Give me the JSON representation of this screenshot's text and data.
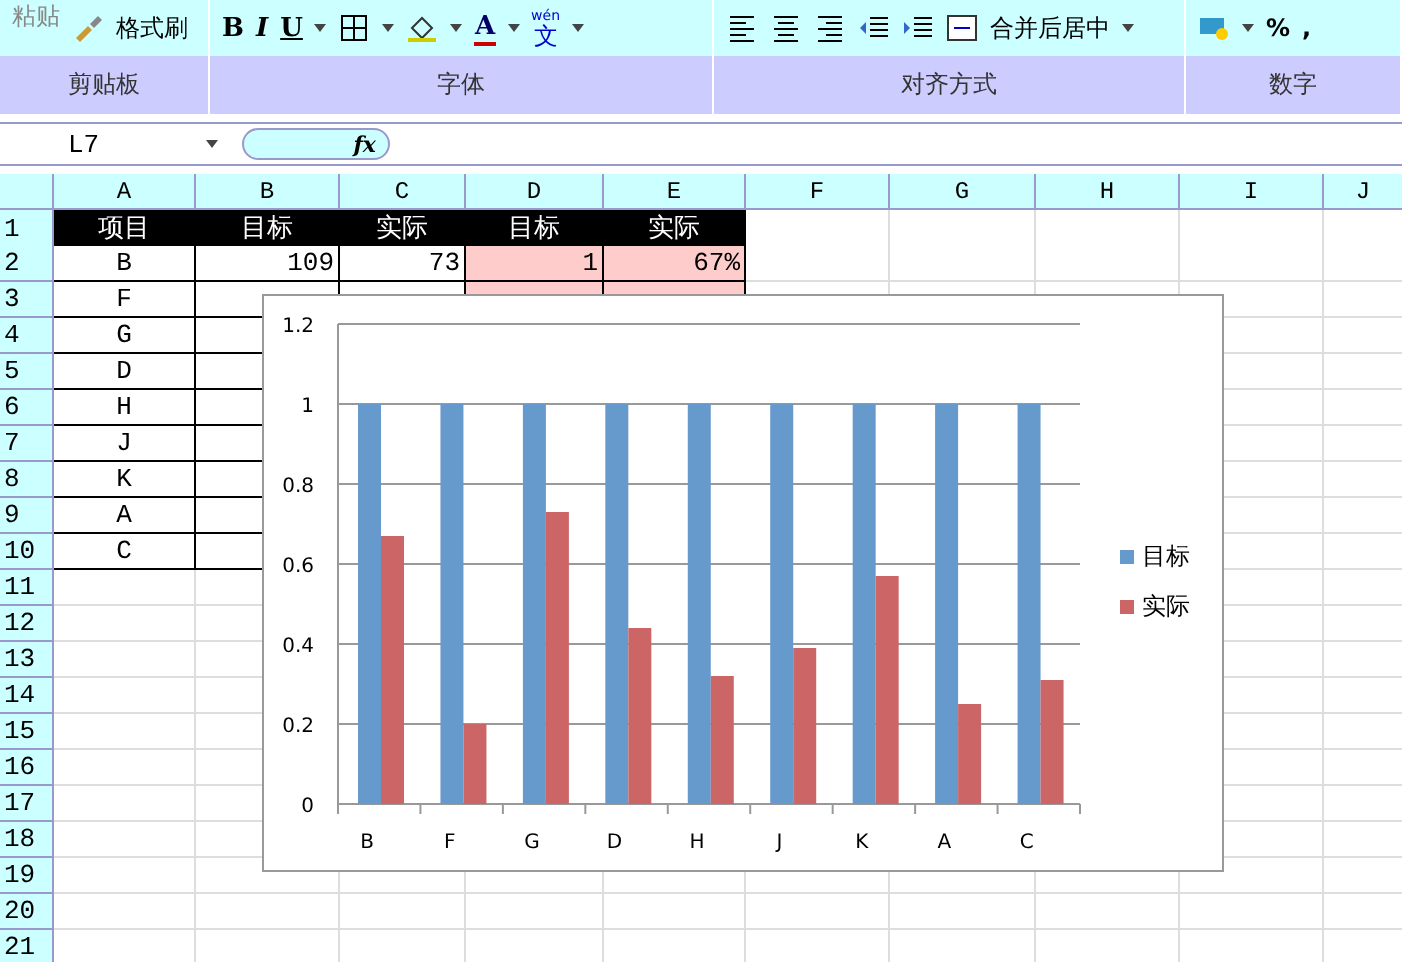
{
  "ribbon": {
    "paste": "粘贴",
    "format_painter": "格式刷",
    "bold": "B",
    "italic": "I",
    "underline": "U",
    "font_color": "A",
    "phonetic_top": "wén",
    "phonetic": "文",
    "merge": "合并后居中",
    "percent": "%",
    "comma": ",",
    "groups": [
      "剪贴板",
      "字体",
      "对齐方式",
      "数字"
    ]
  },
  "formula_bar": {
    "name_box": "L7",
    "fx": "fx"
  },
  "columns": [
    "A",
    "B",
    "C",
    "D",
    "E",
    "F",
    "G",
    "H",
    "I",
    "J"
  ],
  "rows": [
    {
      "number": "1",
      "kind": "header",
      "cells": [
        {
          "text": "项目"
        },
        {
          "text": "目标"
        },
        {
          "text": "实际"
        },
        {
          "text": "目标"
        },
        {
          "text": "实际"
        }
      ]
    },
    {
      "number": "2",
      "kind": "data",
      "cells": [
        {
          "text": "B"
        },
        {
          "text": "109"
        },
        {
          "text": "73"
        },
        {
          "text": "1",
          "shaded": true
        },
        {
          "text": "67%",
          "shaded": true
        }
      ]
    },
    {
      "number": "3",
      "kind": "data",
      "cells": [
        {
          "text": "F"
        },
        {},
        {},
        {
          "shaded": true
        },
        {
          "shaded": true
        }
      ]
    },
    {
      "number": "4",
      "kind": "data",
      "cells": [
        {
          "text": "G"
        },
        {},
        {},
        {},
        {}
      ]
    },
    {
      "number": "5",
      "kind": "data",
      "cells": [
        {
          "text": "D"
        },
        {},
        {},
        {},
        {}
      ]
    },
    {
      "number": "6",
      "kind": "data",
      "cells": [
        {
          "text": "H"
        },
        {},
        {},
        {},
        {}
      ]
    },
    {
      "number": "7",
      "kind": "data",
      "cells": [
        {
          "text": "J"
        },
        {},
        {},
        {},
        {}
      ]
    },
    {
      "number": "8",
      "kind": "data",
      "cells": [
        {
          "text": "K"
        },
        {},
        {},
        {},
        {}
      ]
    },
    {
      "number": "9",
      "kind": "data",
      "cells": [
        {
          "text": "A"
        },
        {},
        {},
        {},
        {}
      ]
    },
    {
      "number": "10",
      "kind": "data",
      "cells": [
        {
          "text": "C"
        },
        {},
        {},
        {},
        {}
      ]
    },
    {
      "number": "11",
      "kind": "empty"
    },
    {
      "number": "12",
      "kind": "empty"
    },
    {
      "number": "13",
      "kind": "empty"
    },
    {
      "number": "14",
      "kind": "empty"
    },
    {
      "number": "15",
      "kind": "empty"
    },
    {
      "number": "16",
      "kind": "empty"
    },
    {
      "number": "17",
      "kind": "empty"
    },
    {
      "number": "18",
      "kind": "empty"
    },
    {
      "number": "19",
      "kind": "empty"
    },
    {
      "number": "20",
      "kind": "empty"
    },
    {
      "number": "21",
      "kind": "empty"
    }
  ],
  "chart": {
    "chart_data": {
      "type": "bar",
      "categories": [
        "B",
        "F",
        "G",
        "D",
        "H",
        "J",
        "K",
        "A",
        "C"
      ],
      "series": [
        {
          "name": "目标",
          "color": "#6699cc",
          "values": [
            1,
            1,
            1,
            1,
            1,
            1,
            1,
            1,
            1
          ]
        },
        {
          "name": "实际",
          "color": "#cc6666",
          "values": [
            0.67,
            0.2,
            0.73,
            0.44,
            0.32,
            0.39,
            0.57,
            0.25,
            0.31
          ]
        }
      ],
      "grid": true,
      "legend": true,
      "ylim": [
        0,
        1.2
      ],
      "yticks": [
        0,
        0.2,
        0.4,
        0.6,
        0.8,
        1,
        1.2
      ]
    }
  }
}
